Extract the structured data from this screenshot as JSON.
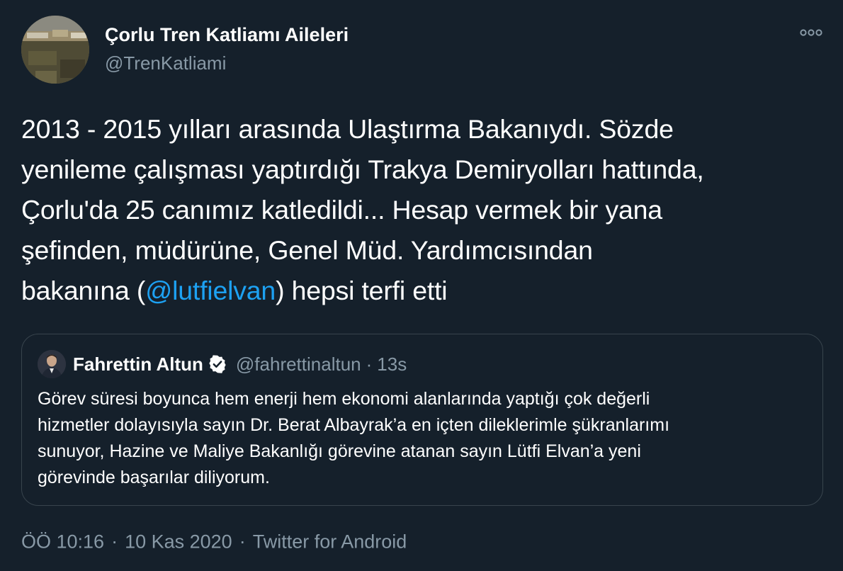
{
  "author": {
    "name": "Çorlu Tren Katliamı Aileleri",
    "handle": "@TrenKatliami",
    "avatar": "train-wreck-photo"
  },
  "tweet": {
    "lines": [
      {
        "text": "2013 - 2015 yılları arasında Ulaştırma Bakanıydı. Sözde"
      },
      {
        "text": "yenileme çalışması yaptırdığı Trakya Demiryolları hattında,"
      },
      {
        "text": "Çorlu'da 25 canımız katledildi... Hesap vermek bir yana"
      },
      {
        "text": "şefinden, müdürüne, Genel Müd. Yardımcısından"
      },
      {
        "before": "bakanına (",
        "mention": "@lutfielvan",
        "after": ") hepsi terfi etti"
      }
    ]
  },
  "quoted": {
    "name": "Fahrettin Altun",
    "verified": true,
    "handle": "@fahrettinaltun",
    "separator": "·",
    "time": "13s",
    "lines": [
      "Görev süresi boyunca hem enerji hem ekonomi alanlarında yaptığı çok değerli",
      "hizmetler dolayısıyla sayın Dr. Berat Albayrak’a en içten dileklerimle şükranlarımı",
      "sunuyor, Hazine ve Maliye Bakanlığı görevine atanan sayın Lütfi Elvan’a yeni",
      "görevinde başarılar diliyorum."
    ]
  },
  "meta": {
    "time": "ÖÖ 10:16",
    "separator": "·",
    "date": "10 Kas 2020",
    "source": "Twitter for Android"
  },
  "icons": {
    "more": "more-horizontal-icon",
    "verified": "verified-badge-icon"
  },
  "colors": {
    "background": "#15202b",
    "text": "#ffffff",
    "secondary": "#8899a6",
    "link": "#1da1f2",
    "border": "#38444d"
  }
}
